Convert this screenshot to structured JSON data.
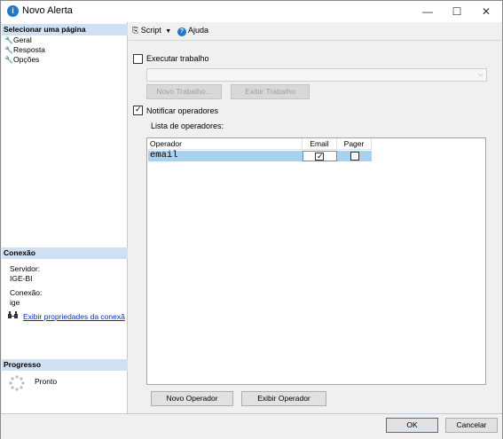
{
  "window": {
    "title": "Novo Alerta",
    "minimize": "—",
    "maximize": "☐",
    "close": "✕"
  },
  "left": {
    "select_page_header": "Selecionar uma página",
    "pages": [
      {
        "label": "Geral"
      },
      {
        "label": "Resposta"
      },
      {
        "label": "Opções"
      }
    ],
    "connection_header": "Conexão",
    "server_label": "Servidor:",
    "server_value": "IGE-BI",
    "connection_label": "Conexão:",
    "connection_value": "ige",
    "view_connection_link": "Exibir propriedades da conexã",
    "progress_header": "Progresso",
    "progress_status": "Pronto"
  },
  "toolbar": {
    "script_label": "Script",
    "help_label": "Ajuda"
  },
  "response": {
    "execute_job_label": "Executar trabalho",
    "execute_job_checked": false,
    "job_combo_value": "",
    "new_job_button": "Novo Trabalho...",
    "view_job_button": "Exibir Trabalho",
    "notify_operators_label": "Notificar operadores",
    "notify_operators_checked": true,
    "operator_list_label": "Lista de operadores:",
    "columns": [
      "Operador",
      "Email",
      "Pager"
    ],
    "rows": [
      {
        "operator": "email",
        "email": true,
        "pager": false
      }
    ],
    "new_operator_button": "Novo Operador",
    "view_operator_button": "Exibir Operador"
  },
  "footer": {
    "ok_button": "OK",
    "cancel_button": "Cancelar"
  }
}
